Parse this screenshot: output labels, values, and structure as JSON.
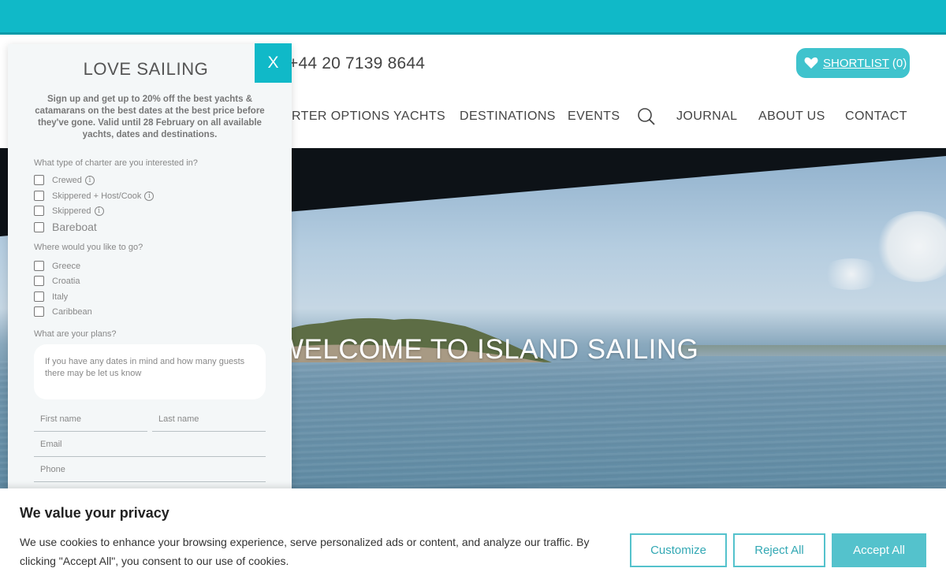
{
  "header": {
    "phone": "+44 20 7139 8644",
    "shortlist_label": "SHORTLIST",
    "shortlist_count": "(0)"
  },
  "nav": {
    "items": [
      "CHARTER OPTIONS",
      "YACHTS",
      "DESTINATIONS",
      "EVENTS",
      "JOURNAL",
      "ABOUT US",
      "CONTACT"
    ]
  },
  "hero": {
    "title": "WELCOME TO ISLAND SAILING"
  },
  "popup": {
    "close_label": "X",
    "title": "LOVE SAILING",
    "subtitle": "Sign up and get up to 20% off the best yachts & catamarans on the best dates at the best price before they've gone. Valid until 28 February on all available yachts, dates and destinations.",
    "charter_question": "What type of charter are you interested in?",
    "charter_options": [
      "Crewed",
      "Skippered + Host/Cook",
      "Skippered",
      "Bareboat"
    ],
    "destination_question": "Where would you like to go?",
    "destination_options": [
      "Greece",
      "Croatia",
      "Italy",
      "Caribbean"
    ],
    "plans_question": "What are your plans?",
    "plans_placeholder": "If you have any dates in mind and how many guests there may be let us know",
    "first_name_placeholder": "First name",
    "last_name_placeholder": "Last name",
    "email_placeholder": "Email",
    "phone_placeholder": "Phone"
  },
  "cookie": {
    "title": "We value your privacy",
    "text": "We use cookies to enhance your browsing experience, serve personalized ads or content, and analyze our traffic. By clicking \"Accept All\", you consent to our use of cookies.",
    "customize_label": "Customize",
    "reject_label": "Reject All",
    "accept_label": "Accept All"
  },
  "colors": {
    "accent": "#10b9c8",
    "button": "#54c2cc"
  }
}
